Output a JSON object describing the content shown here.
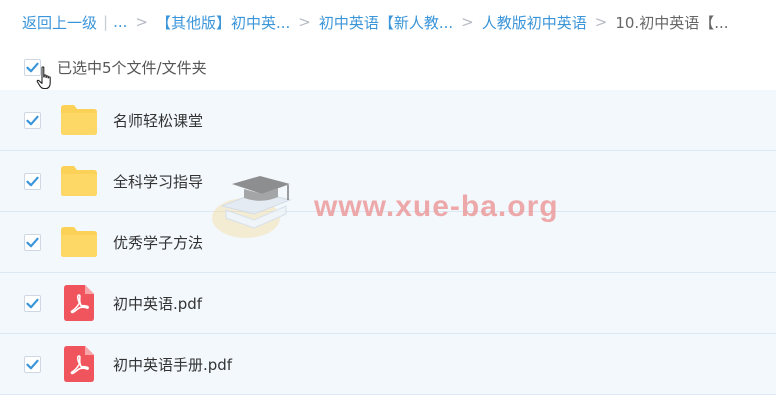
{
  "breadcrumb": {
    "back": "返回上一级",
    "divider": "|",
    "ellipsis": "...",
    "separator": ">",
    "items": [
      "【其他版】初中英...",
      "初中英语【新人教...",
      "人教版初中英语"
    ],
    "current": "10.初中英语【..."
  },
  "selection": {
    "label": "已选中5个文件/文件夹",
    "all_checked": true
  },
  "files": [
    {
      "name": "名师轻松课堂",
      "type": "folder",
      "checked": true
    },
    {
      "name": "全科学习指导",
      "type": "folder",
      "checked": true
    },
    {
      "name": "优秀学子方法",
      "type": "folder",
      "checked": true
    },
    {
      "name": "初中英语.pdf",
      "type": "pdf",
      "checked": true
    },
    {
      "name": "初中英语手册.pdf",
      "type": "pdf",
      "checked": true
    }
  ],
  "watermark": {
    "text": "www.xue-ba.org"
  },
  "colors": {
    "link": "#3b95d9",
    "check": "#3b95d9",
    "folder": "#fcd158",
    "pdf": "#f0555e",
    "row_bg": "#f3f8fd"
  },
  "icons": {
    "folder": "folder-icon",
    "pdf": "pdf-file-icon",
    "check": "checkmark-icon",
    "cursor": "hand-pointer-icon",
    "watermark_logo": "graduation-cap-icon"
  }
}
